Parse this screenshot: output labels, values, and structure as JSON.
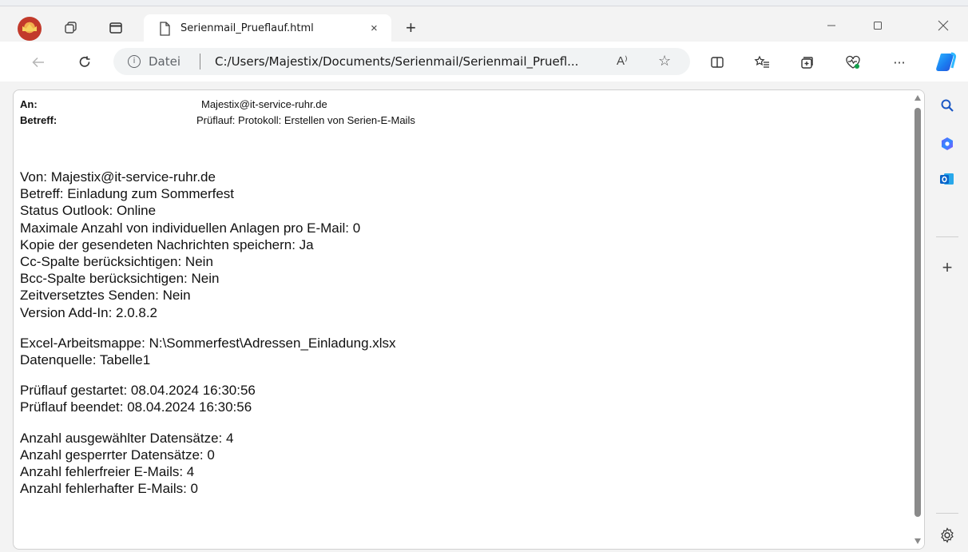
{
  "browser": {
    "tab": {
      "title": "Serienmail_Prueflauf.html",
      "close_glyph": "×"
    },
    "new_tab_glyph": "+",
    "window_controls": {
      "minimize": "—",
      "maximize": "☐",
      "close": "✕"
    },
    "address": {
      "protocol_label": "Datei",
      "url": "C:/Users/Majestix/Documents/Serienmail/Serienmail_Pruefl...",
      "read_aloud_glyph": "A⁾",
      "favorite_glyph": "☆"
    },
    "toolbar_glyphs": {
      "more": "···"
    }
  },
  "email": {
    "to_label": "An:",
    "to_value": "Majestix@it-service-ruhr.de",
    "subject_label": "Betreff:",
    "subject_value": "Prüflauf: Protokoll: Erstellen von Serien-E-Mails"
  },
  "report": {
    "block1": [
      "Von: Majestix@it-service-ruhr.de",
      "Betreff:  Einladung zum Sommerfest",
      "Status Outlook: Online",
      "Maximale Anzahl von individuellen Anlagen pro E-Mail: 0",
      "Kopie der gesendeten Nachrichten speichern: Ja",
      "Cc-Spalte berücksichtigen: Nein",
      "Bcc-Spalte berücksichtigen: Nein",
      "Zeitversetztes Senden: Nein",
      "Version Add-In: 2.0.8.2"
    ],
    "block2": [
      "Excel-Arbeitsmappe:  N:\\Sommerfest\\Adressen_Einladung.xlsx",
      "Datenquelle: Tabelle1"
    ],
    "block3": [
      "Prüflauf gestartet: 08.04.2024 16:30:56",
      "Prüflauf beendet: 08.04.2024 16:30:56"
    ],
    "block4": [
      "Anzahl ausgewählter Datensätze: 4",
      "Anzahl gesperrter Datensätze: 0",
      "Anzahl fehlerfreier E-Mails: 4",
      "Anzahl fehlerhafter E-Mails: 0"
    ]
  },
  "sidebar": {
    "icons": [
      "search-icon",
      "copilot-sidebar-icon",
      "outlook-icon",
      "add-icon",
      "settings-icon"
    ],
    "add_glyph": "+"
  },
  "colors": {
    "chrome": "#f3f3f3",
    "page": "#ffffff",
    "accent_blue": "#0a63c9",
    "outlook_blue": "#0a64c9"
  }
}
